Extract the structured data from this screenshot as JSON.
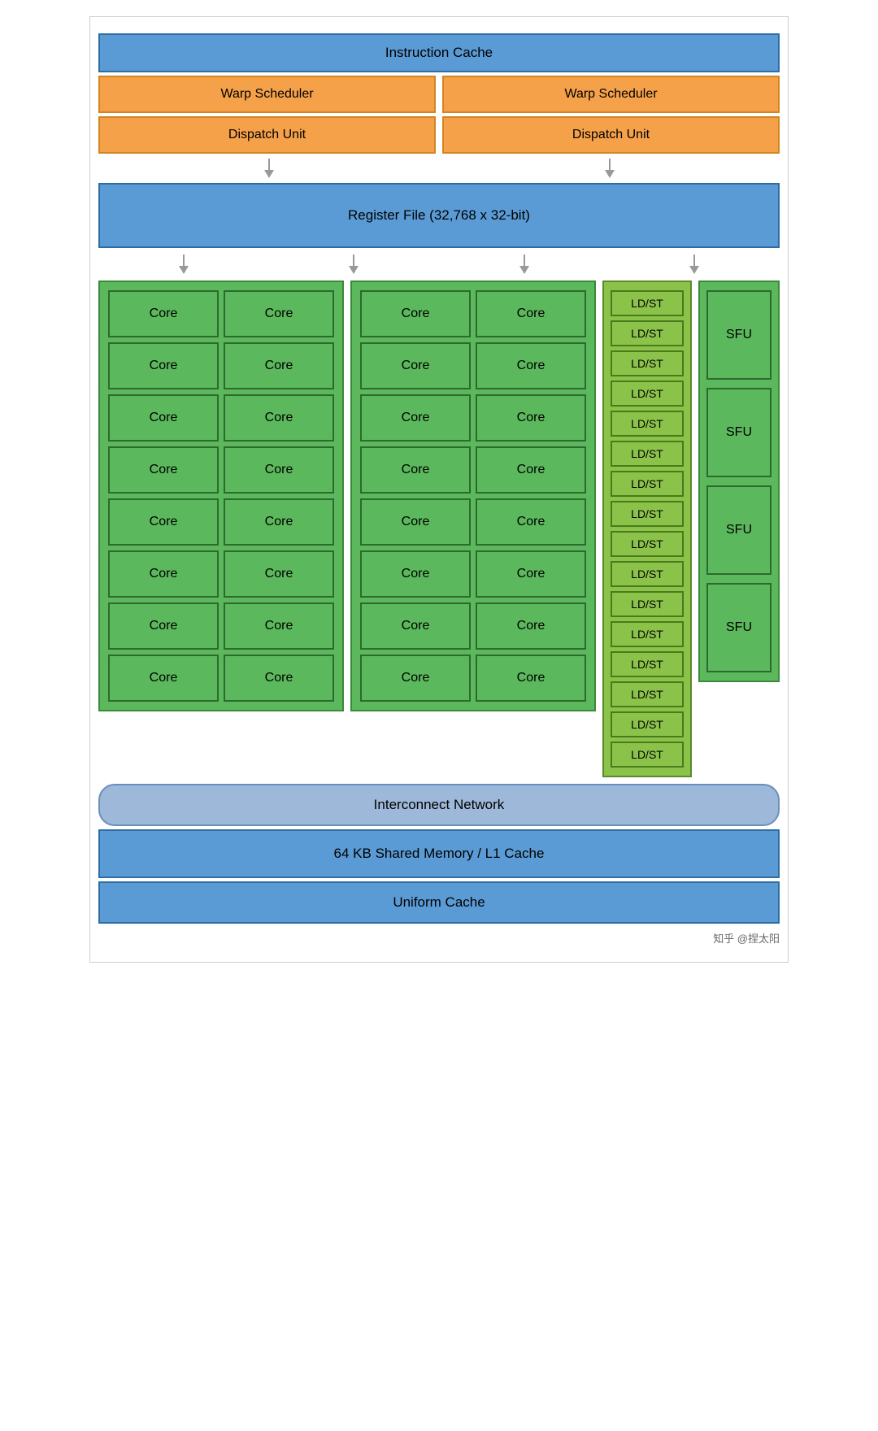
{
  "diagram": {
    "instruction_cache": "Instruction Cache",
    "warp_scheduler_1": "Warp Scheduler",
    "warp_scheduler_2": "Warp Scheduler",
    "dispatch_unit_1": "Dispatch Unit",
    "dispatch_unit_2": "Dispatch Unit",
    "register_file": "Register File (32,768 x 32-bit)",
    "core_label": "Core",
    "ldst_label": "LD/ST",
    "sfu_label": "SFU",
    "interconnect": "Interconnect Network",
    "shared_memory": "64 KB Shared Memory / L1 Cache",
    "uniform_cache": "Uniform Cache",
    "watermark": "知乎 @捏太阳"
  }
}
